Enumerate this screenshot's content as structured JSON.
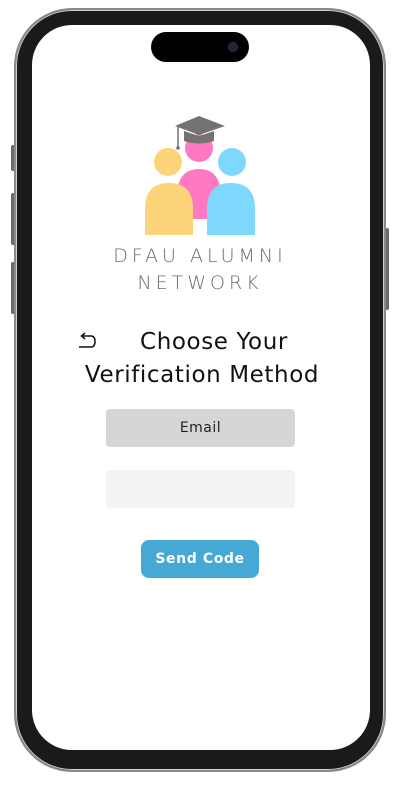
{
  "app": {
    "brand_line1": "DFAU ALUMNI",
    "brand_line2": "NETWORK"
  },
  "verification": {
    "heading_line1": "Choose Your",
    "heading_line2": "Verification Method",
    "method_label": "Email",
    "code_value": "",
    "send_label": "Send Code"
  },
  "icons": {
    "back": "undo-arrow-icon",
    "logo": "graduation-cap-people-logo"
  },
  "colors": {
    "accent": "#46a9d5",
    "method_button_bg": "#d6d6d6",
    "input_bg": "#f3f3f3",
    "logo_yellow": "#fdd47a",
    "logo_pink": "#ff78c2",
    "logo_blue": "#7ed7fd",
    "logo_cap": "#737373"
  }
}
